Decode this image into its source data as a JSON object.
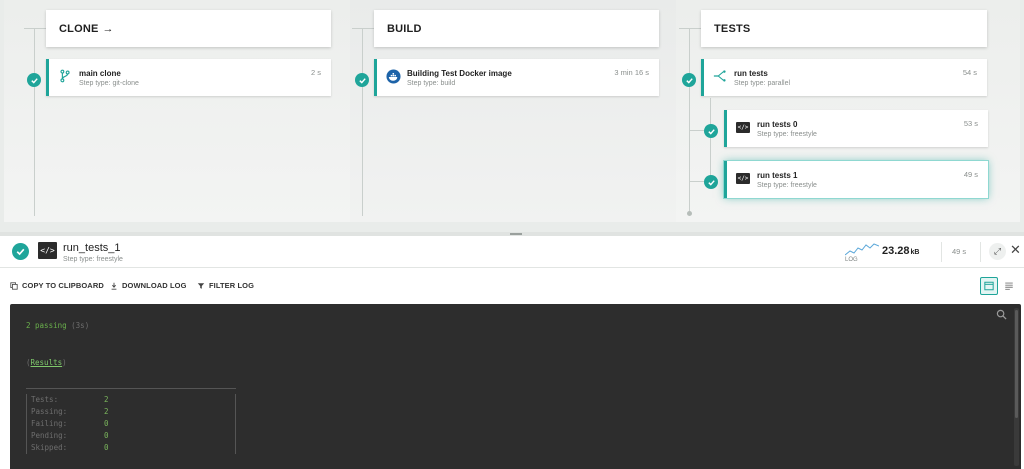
{
  "stages": [
    {
      "title": "CLONE",
      "arrow": "→"
    },
    {
      "title": "BUILD"
    },
    {
      "title": "TESTS"
    }
  ],
  "steps": [
    {
      "name": "main clone",
      "type": "Step type: git-clone",
      "duration": "2 s",
      "icon": "git-branch-icon"
    },
    {
      "name": "Building Test Docker image",
      "type": "Step type: build",
      "duration": "3 min 16 s",
      "icon": "docker-icon"
    },
    {
      "name": "run tests",
      "type": "Step type: parallel",
      "duration": "54 s",
      "icon": "parallel-icon"
    },
    {
      "name": "run tests 0",
      "type": "Step type: freestyle",
      "duration": "53 s",
      "icon": "terminal-icon"
    },
    {
      "name": "run tests 1",
      "type": "Step type: freestyle",
      "duration": "49 s",
      "icon": "terminal-icon"
    }
  ],
  "details": {
    "title": "run_tests_1",
    "subtitle": "Step type: freestyle",
    "log_label": "LOG",
    "log_size": "23.28",
    "log_unit": "kB",
    "duration": "49 s"
  },
  "toolbar": {
    "copy": "COPY TO CLIPBOARD",
    "download": "DOWNLOAD LOG",
    "filter": "FILTER LOG"
  },
  "console": {
    "passing": "2 passing",
    "passing_time": "(3s)",
    "results_open": "(",
    "results_link": "Results",
    "results_close": ")",
    "rows": [
      {
        "label": "Tests:",
        "value": "2"
      },
      {
        "label": "Passing:",
        "value": "2"
      },
      {
        "label": "Failing:",
        "value": "0"
      },
      {
        "label": "Pending:",
        "value": "0"
      },
      {
        "label": "Skipped:",
        "value": "0"
      }
    ]
  },
  "colors": {
    "accent": "#1fa59a",
    "console_bg": "#2d2d2d",
    "console_green": "#6ab04c"
  }
}
